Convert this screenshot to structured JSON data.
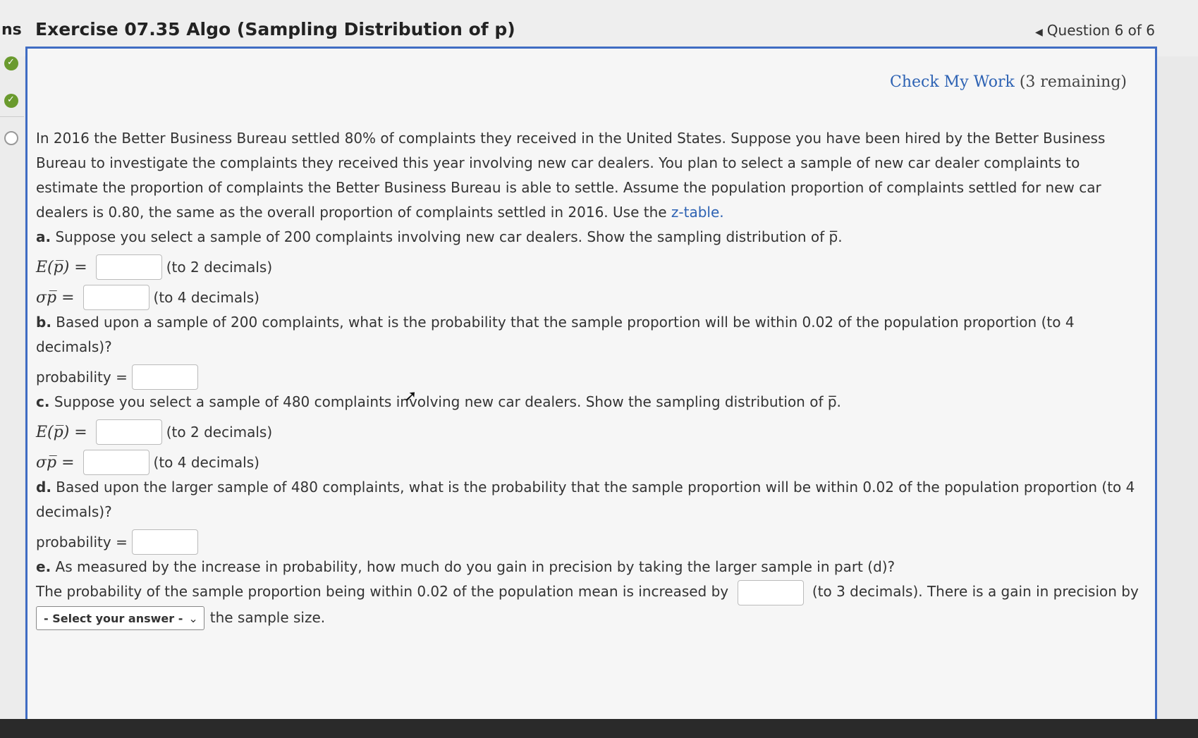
{
  "header": {
    "left_fragment": "ns",
    "title": "Exercise 07.35 Algo (Sampling Distribution of p)",
    "question_nav": "Question 6 of 6"
  },
  "check_my_work": {
    "label": "Check My Work",
    "remaining": "(3 remaining)"
  },
  "problem": {
    "intro": "In 2016 the Better Business Bureau settled 80% of complaints they received in the United States. Suppose you have been hired by the Better Business Bureau to investigate the complaints they received this year involving new car dealers. You plan to select a sample of new car dealer complaints to estimate the proportion of complaints the Better Business Bureau is able to settle. Assume the population proportion of complaints settled for new car dealers is 0.80, the same as the overall proportion of complaints settled in 2016. Use the",
    "ztable_link": "z-table.",
    "part_a": {
      "label": "a.",
      "text": "Suppose you select a sample of 200 complaints involving new car dealers. Show the sampling distribution of p̅."
    },
    "part_a_rows": [
      {
        "symbol": "E(p̅) =",
        "hint": "(to 2 decimals)"
      },
      {
        "symbol": "σp̅ =",
        "hint": "(to 4 decimals)"
      }
    ],
    "part_b": {
      "label": "b.",
      "text": "Based upon a sample of 200 complaints, what is the probability that the sample proportion will be within 0.02 of the population proportion (to 4 decimals)?"
    },
    "part_b_row": {
      "label": "probability ="
    },
    "part_c": {
      "label": "c.",
      "text": "Suppose you select a sample of 480 complaints involving new car dealers. Show the sampling distribution of p̅."
    },
    "part_c_rows": [
      {
        "symbol": "E(p̅) =",
        "hint": "(to 2 decimals)"
      },
      {
        "symbol": "σp̅ =",
        "hint": "(to 4 decimals)"
      }
    ],
    "part_d": {
      "label": "d.",
      "text": "Based upon the larger sample of 480 complaints, what is the probability that the sample proportion will be within 0.02 of the population proportion (to 4 decimals)?"
    },
    "part_d_row": {
      "label": "probability ="
    },
    "part_e": {
      "label": "e.",
      "text": "As measured by the increase in probability, how much do you gain in precision by taking the larger sample in part (d)?"
    },
    "part_e_sentence_1": "The probability of the sample proportion being within 0.02 of the population mean is increased by",
    "part_e_sentence_2": "(to 3 decimals). There is a gain in precision by",
    "part_e_select": "- Select your answer -",
    "part_e_sentence_3": "the sample size."
  },
  "colors": {
    "accent": "#3f6cc3",
    "link": "#2d62b3",
    "check": "#6a9a2e"
  }
}
